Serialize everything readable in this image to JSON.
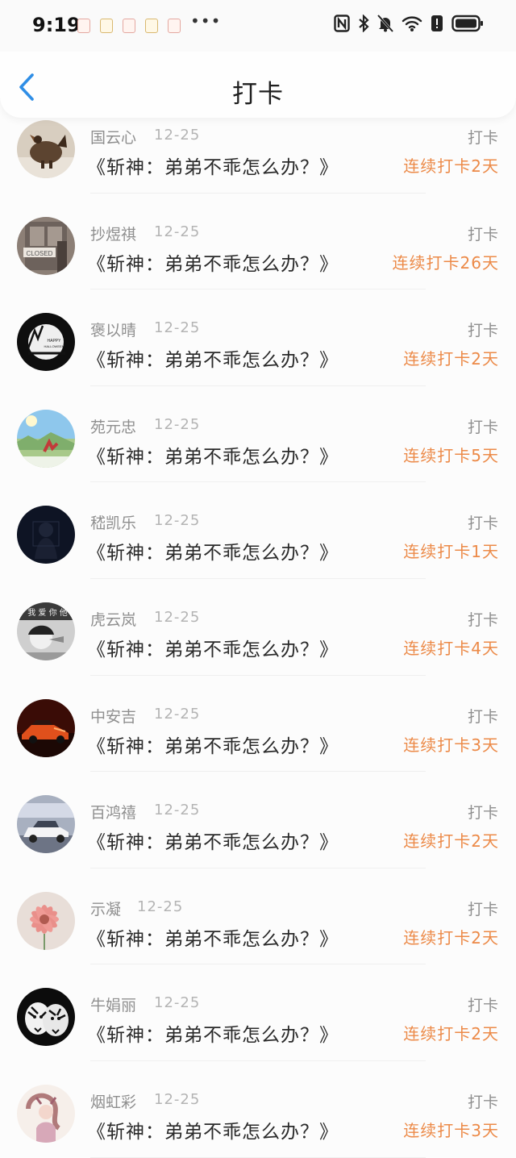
{
  "status_bar": {
    "time": "9:19",
    "overflow": "•••",
    "notification_icons": [
      "app-notification-icon",
      "app-notification-icon",
      "app-notification-icon",
      "app-notification-icon",
      "app-notification-icon"
    ],
    "system_icons": [
      "nfc-icon",
      "bluetooth-icon",
      "bell-muted-icon",
      "wifi-icon",
      "alert-icon",
      "battery-icon"
    ]
  },
  "header": {
    "title": "打卡",
    "back_icon": "chevron-left-icon"
  },
  "colors": {
    "accent_blue": "#2f8ee6",
    "streak_orange": "#ec8a48",
    "secondary_text": "#8f8f8f"
  },
  "checkins": [
    {
      "name": "国云心",
      "date": "12-25",
      "book": "《斩神：弟弟不乖怎么办？》",
      "action": "打卡",
      "streak": "连续打卡2天",
      "avatar_icon": "rooster-avatar"
    },
    {
      "name": "抄煜祺",
      "date": "12-25",
      "book": "《斩神：弟弟不乖怎么办？》",
      "action": "打卡",
      "streak": "连续打卡26天",
      "avatar_icon": "closed-door-avatar"
    },
    {
      "name": "褒以晴",
      "date": "12-25",
      "book": "《斩神：弟弟不乖怎么办？》",
      "action": "打卡",
      "streak": "连续打卡2天",
      "avatar_icon": "halloween-avatar"
    },
    {
      "name": "苑元忠",
      "date": "12-25",
      "book": "《斩神：弟弟不乖怎么办？》",
      "action": "打卡",
      "streak": "连续打卡5天",
      "avatar_icon": "landscape-avatar"
    },
    {
      "name": "嵇凯乐",
      "date": "12-25",
      "book": "《斩神：弟弟不乖怎么办？》",
      "action": "打卡",
      "streak": "连续打卡1天",
      "avatar_icon": "dark-figure-avatar"
    },
    {
      "name": "虎云岚",
      "date": "12-25",
      "book": "《斩神：弟弟不乖怎么办？》",
      "action": "打卡",
      "streak": "连续打卡4天",
      "avatar_icon": "portrait-avatar"
    },
    {
      "name": "中安吉",
      "date": "12-25",
      "book": "《斩神：弟弟不乖怎么办？》",
      "action": "打卡",
      "streak": "连续打卡3天",
      "avatar_icon": "sports-car-avatar"
    },
    {
      "name": "百鸿禧",
      "date": "12-25",
      "book": "《斩神：弟弟不乖怎么办？》",
      "action": "打卡",
      "streak": "连续打卡2天",
      "avatar_icon": "suv-avatar"
    },
    {
      "name": "示凝",
      "date": "12-25",
      "book": "《斩神：弟弟不乖怎么办？》",
      "action": "打卡",
      "streak": "连续打卡2天",
      "avatar_icon": "flower-avatar"
    },
    {
      "name": "牛娟丽",
      "date": "12-25",
      "book": "《斩神：弟弟不乖怎么办？》",
      "action": "打卡",
      "streak": "连续打卡2天",
      "avatar_icon": "tiger-avatar"
    },
    {
      "name": "烟虹彩",
      "date": "12-25",
      "book": "《斩神：弟弟不乖怎么办？》",
      "action": "打卡",
      "streak": "连续打卡3天",
      "avatar_icon": "illustration-avatar"
    }
  ]
}
